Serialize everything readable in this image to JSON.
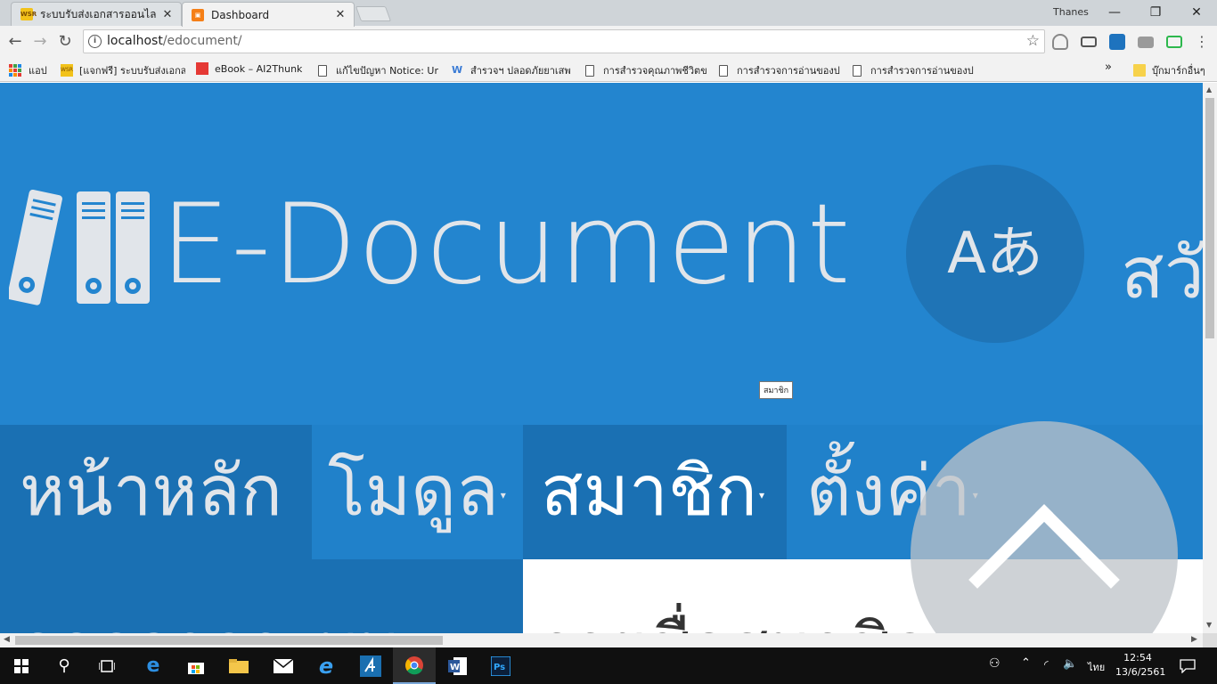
{
  "browser": {
    "tabs": [
      {
        "title": "ระบบรับส่งเอกสารออนไลน์ หรือ",
        "favicon_text": "WSR",
        "favicon_color": "#f2c21a",
        "active": false
      },
      {
        "title": "Dashboard",
        "favicon_text": "▣",
        "favicon_color": "#f57f17",
        "active": true
      }
    ],
    "user": "Thanes",
    "window_controls": {
      "minimize": "—",
      "maximize": "❐",
      "close": "✕"
    },
    "nav": {
      "back": "←",
      "forward": "→",
      "reload": "↻"
    },
    "url_host": "localhost",
    "url_path": "/edocument/",
    "bookmarks": [
      {
        "label": "แอป",
        "icon": "apps-grid-icon"
      },
      {
        "label": "[แจกฟรี] ระบบรับส่งเอกส",
        "icon": "wsr-icon"
      },
      {
        "label": "eBook – AI2Thunk",
        "icon": "ai2-icon"
      },
      {
        "label": "แก้ไขปัญหา Notice: Ur",
        "icon": "page-icon"
      },
      {
        "label": "สำรวจฯ ปลอดภัยยาเสพ",
        "icon": "survey-icon"
      },
      {
        "label": "การสำรวจคุณภาพชีวิตข",
        "icon": "page-icon"
      },
      {
        "label": "การสำรวจการอ่านของป",
        "icon": "page-icon"
      },
      {
        "label": "การสำรวจการอ่านของป",
        "icon": "page-icon"
      }
    ],
    "bookmarks_overflow": "»",
    "other_bookmarks": "บุ๊กมาร์กอื่นๆ"
  },
  "page": {
    "brand": "E-Document",
    "lang_button": "Aあ",
    "greeting": "สวั",
    "menu": [
      {
        "label": "หน้าหลัก",
        "caret": ""
      },
      {
        "label": "โมดูล",
        "caret": "▾"
      },
      {
        "label": "สมาชิก",
        "caret": "▾"
      },
      {
        "label": "ตั้งค่า",
        "caret": "▾"
      }
    ],
    "tooltip": "สมาชิก",
    "sidebar_heading": "ออกจากระบบ",
    "content_heading": "รายชื่อสมาชิก"
  },
  "taskbar": {
    "clock_time": "12:54",
    "clock_date": "13/6/2561",
    "language": "ไทย"
  },
  "colors": {
    "page_bg": "#2385cf",
    "menu_dark": "#1a70b3",
    "text_light": "#e1e5ea"
  }
}
